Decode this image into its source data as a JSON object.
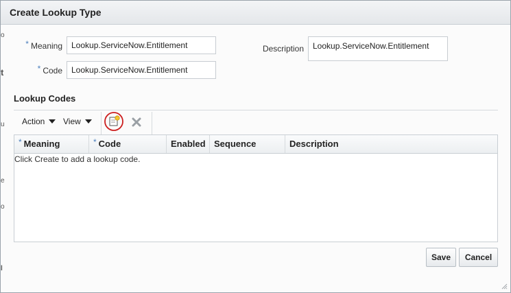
{
  "dialog": {
    "title": "Create Lookup Type"
  },
  "form": {
    "meaning": {
      "label": "Meaning",
      "required_mark": "*",
      "value": "Lookup.ServiceNow.Entitlement"
    },
    "code": {
      "label": "Code",
      "required_mark": "*",
      "value": "Lookup.ServiceNow.Entitlement"
    },
    "description": {
      "label": "Description",
      "value": "Lookup.ServiceNow.Entitlement"
    }
  },
  "lookup_codes": {
    "title": "Lookup Codes",
    "toolbar": {
      "action_label": "Action",
      "view_label": "View",
      "create_icon": "create-icon",
      "delete_icon": "delete-icon",
      "create_highlight_color": "#cc1f1f"
    },
    "columns": [
      {
        "label": "Meaning",
        "required_mark": "*"
      },
      {
        "label": "Code",
        "required_mark": "*"
      },
      {
        "label": "Enabled",
        "required_mark": ""
      },
      {
        "label": "Sequence",
        "required_mark": ""
      },
      {
        "label": "Description",
        "required_mark": ""
      }
    ],
    "empty_message": "Click Create to add a lookup code."
  },
  "buttons": {
    "save_label": "Save",
    "cancel_label": "Cancel"
  },
  "colors": {
    "required_mark": "#4c7fbd",
    "border": "#c8ced3"
  }
}
